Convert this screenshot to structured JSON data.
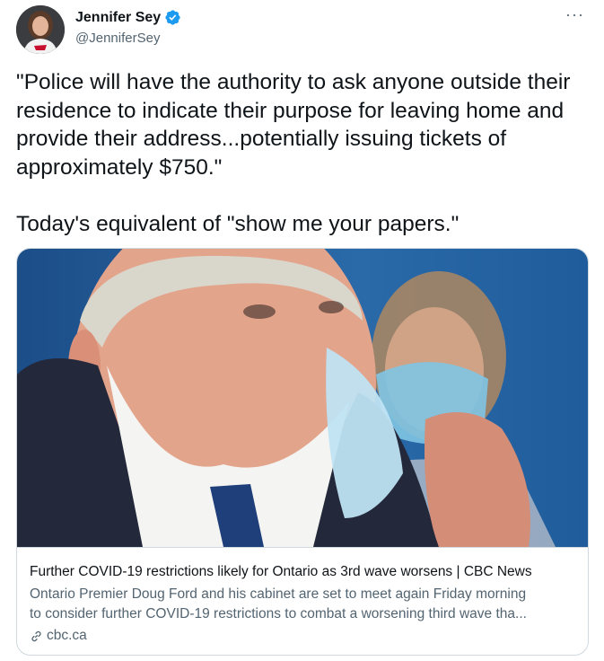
{
  "author": {
    "display_name": "Jennifer Sey",
    "handle": "@JenniferSey",
    "verified_icon": "verified-badge-icon"
  },
  "menu": {
    "more_label": "···"
  },
  "tweet": {
    "text": "\"Police will have the authority to ask anyone outside their residence to indicate their purpose for leaving home and provide their address...potentially issuing tickets of approximately $750.\"\n\nToday's equivalent of \"show me your papers.\""
  },
  "card": {
    "title": "Further COVID-19 restrictions likely for Ontario as 3rd wave worsens | CBC News",
    "description_line1": "Ontario Premier Doug Ford and his cabinet are set to meet again Friday morning",
    "description_line2": "to consider further COVID-19 restrictions to combat a worsening third wave tha...",
    "domain": "cbc.ca",
    "domain_icon": "link-icon"
  },
  "colors": {
    "text_primary": "#0f1419",
    "text_secondary": "#536471",
    "verified_blue": "#1d9bf0",
    "border": "#cfd9de"
  }
}
